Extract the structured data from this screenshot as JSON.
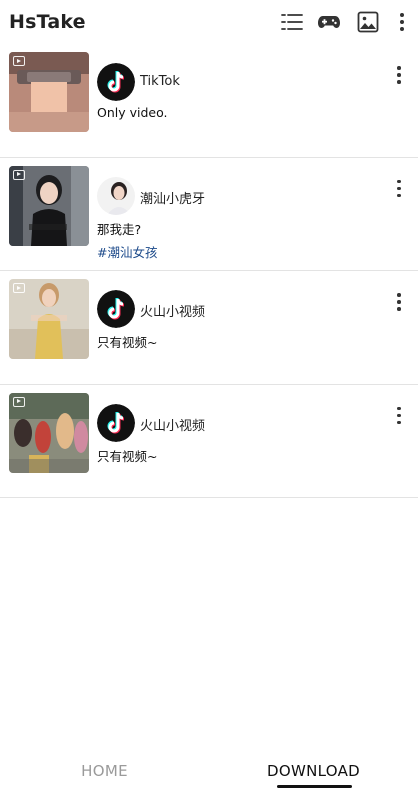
{
  "app": {
    "title": "HsTake",
    "actions": [
      {
        "icon": "list-icon"
      },
      {
        "icon": "gamepad-icon"
      },
      {
        "icon": "image-icon"
      },
      {
        "icon": "more-vert-icon"
      }
    ]
  },
  "list": {
    "items": [
      {
        "author": "TikTok",
        "description": "Only video.",
        "tag": "",
        "avatar": "tiktok-logo-icon",
        "thumb_icon": "video-icon"
      },
      {
        "author": "潮汕小虎牙",
        "description": "那我走?",
        "tag": "#潮汕女孩",
        "avatar": "user-avatar",
        "thumb_icon": "video-icon"
      },
      {
        "author": "火山小视频",
        "description": "只有视频~",
        "tag": "",
        "avatar": "tiktok-logo-icon",
        "thumb_icon": "video-icon"
      },
      {
        "author": "火山小视频",
        "description": "只有视频~",
        "tag": "",
        "avatar": "tiktok-logo-icon",
        "thumb_icon": "video-icon"
      }
    ]
  },
  "bottom_nav": {
    "tabs": [
      {
        "label": "HOME",
        "selected": false
      },
      {
        "label": "DOWNLOAD",
        "selected": true
      }
    ]
  },
  "colors": {
    "background": "#ffffff",
    "inactive_tab": "#9a9a9a",
    "active_tab": "#111111",
    "hashtag": "#1c4a8a",
    "divider": "#e3e3e3"
  }
}
